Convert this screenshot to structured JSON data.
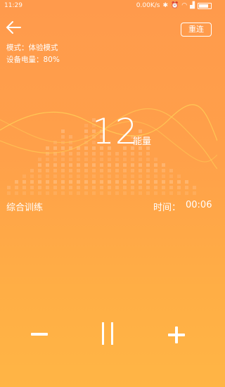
{
  "status_bar": {
    "time": "11:29",
    "network_speed": "0.00K/s"
  },
  "header": {
    "reconnect_label": "重连"
  },
  "device": {
    "mode": "模式：体验模式",
    "battery": "设备电量：80%"
  },
  "session": {
    "score": "12",
    "score_unit": "能量",
    "program": "综合训练",
    "timer_label": "时间：",
    "timer_value": "00:06"
  },
  "controls": {
    "decrease_icon": "minus-icon",
    "pause_icon": "pause-icon",
    "increase_icon": "plus-icon"
  },
  "colors": {
    "bg_top": "#ff9a4c",
    "bg_bottom": "#ffb545",
    "wave": "#ffd45a"
  }
}
